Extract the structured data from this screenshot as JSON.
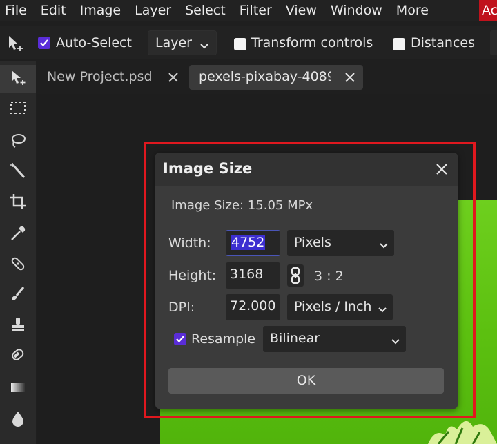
{
  "menu": {
    "items": [
      "File",
      "Edit",
      "Image",
      "Layer",
      "Select",
      "Filter",
      "View",
      "Window",
      "More"
    ],
    "account": "Ac"
  },
  "options": {
    "auto_select_label": "Auto-Select",
    "auto_select_checked": true,
    "layer_select_value": "Layer",
    "transform_controls_label": "Transform controls",
    "distances_label": "Distances"
  },
  "tabs": [
    {
      "label": "New Project.psd"
    },
    {
      "label": "pexels-pixabay-4089"
    }
  ],
  "dialog": {
    "title": "Image Size",
    "info": "Image Size: 15.05 MPx",
    "width_label": "Width:",
    "width_value": "4752",
    "width_unit": "Pixels",
    "height_label": "Height:",
    "height_value": "3168",
    "ratio": "3 : 2",
    "dpi_label": "DPI:",
    "dpi_value": "72.000",
    "dpi_unit": "Pixels / Inch",
    "resample_label": "Resample",
    "resample_checked": true,
    "resample_method": "Bilinear",
    "ok_label": "OK"
  },
  "colors": {
    "accent": "#5a2dd8",
    "highlight": "#e0181f",
    "account": "#c0121c",
    "image_green": "#5cc010"
  }
}
